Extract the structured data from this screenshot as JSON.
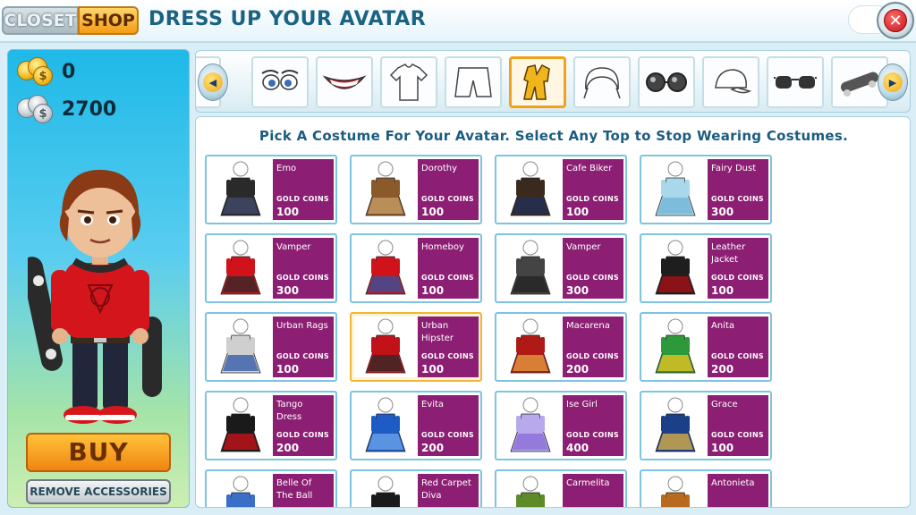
{
  "header": {
    "tabs": [
      {
        "label": "CLOSET"
      },
      {
        "label": "SHOP"
      }
    ],
    "title": "DRESS UP YOUR AVATAR",
    "close_glyph": "✕"
  },
  "wallet": {
    "gold": "0",
    "silver": "2700"
  },
  "avatar": {
    "buy_label": "BUY",
    "remove_label": "REMOVE ACCESSORIES"
  },
  "categories": [
    {
      "icon": "eyes-icon"
    },
    {
      "icon": "mouth-icon"
    },
    {
      "icon": "shirt-icon"
    },
    {
      "icon": "shorts-icon"
    },
    {
      "icon": "costume-icon",
      "selected": true
    },
    {
      "icon": "hair-icon"
    },
    {
      "icon": "glasses-icon"
    },
    {
      "icon": "cap-icon"
    },
    {
      "icon": "sunglasses-icon"
    },
    {
      "icon": "skateboard-icon"
    }
  ],
  "instruction": "Pick A Costume For Your Avatar. Select Any Top to Stop Wearing Costumes.",
  "currency_label": "GOLD COINS",
  "costumes": [
    {
      "name": "Emo",
      "price": "100",
      "color": "#2a2a2a",
      "accent": "#444c6e"
    },
    {
      "name": "Dorothy",
      "price": "100",
      "color": "#8a5a2b",
      "accent": "#c9a06a"
    },
    {
      "name": "Cafe Biker",
      "price": "100",
      "color": "#3a2a1e",
      "accent": "#20305c"
    },
    {
      "name": "Fairy Dust",
      "price": "300",
      "color": "#a9d8ea",
      "accent": "#6fb3d6"
    },
    {
      "name": "Vamper",
      "price": "300",
      "color": "#d0131a",
      "accent": "#2a2a2a"
    },
    {
      "name": "Homeboy",
      "price": "100",
      "color": "#d0131a",
      "accent": "#2b55a8"
    },
    {
      "name": "Vamper",
      "price": "300",
      "color": "#444444",
      "accent": "#222222"
    },
    {
      "name": "Leather Jacket",
      "price": "100",
      "color": "#1e1e1e",
      "accent": "#b01015"
    },
    {
      "name": "Urban Rags",
      "price": "100",
      "color": "#cfcfcf",
      "accent": "#2b55a8"
    },
    {
      "name": "Urban Hipster",
      "price": "100",
      "color": "#c1121a",
      "accent": "#2a2a2a",
      "selected": true
    },
    {
      "name": "Macarena",
      "price": "200",
      "color": "#b01a16",
      "accent": "#e6a040"
    },
    {
      "name": "Anita",
      "price": "200",
      "color": "#2c9a3a",
      "accent": "#f2c51e"
    },
    {
      "name": "Tango Dress",
      "price": "200",
      "color": "#1a1a1a",
      "accent": "#d0131a"
    },
    {
      "name": "Evita",
      "price": "200",
      "color": "#1f5bc4",
      "accent": "#6ea6ec"
    },
    {
      "name": "Ise Girl",
      "price": "400",
      "color": "#b8a8ec",
      "accent": "#8a6bd8"
    },
    {
      "name": "Grace",
      "price": "100",
      "color": "#1c3f8a",
      "accent": "#e2b640"
    },
    {
      "name": "Belle Of The Ball",
      "price": "",
      "color": "#3a6fc8",
      "accent": "#8fb6ea"
    },
    {
      "name": "Red Carpet Diva",
      "price": "",
      "color": "#1a1a1a",
      "accent": "#cccccc"
    },
    {
      "name": "Carmelita",
      "price": "",
      "color": "#5e8a2a",
      "accent": "#e0b020"
    },
    {
      "name": "Antonieta",
      "price": "",
      "color": "#b86b1e",
      "accent": "#6b3a10"
    }
  ]
}
